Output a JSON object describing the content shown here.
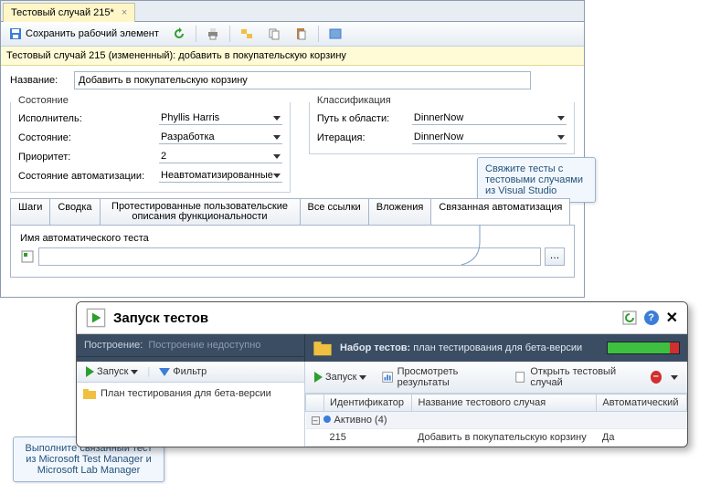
{
  "tab_title": "Тестовый случай 215*",
  "toolbar": {
    "save_label": "Сохранить рабочий элемент"
  },
  "info_bar": "Тестовый случай 215 (измененный): добавить в покупательскую корзину",
  "title_field": {
    "label": "Название:",
    "value": "Добавить в покупательскую корзину"
  },
  "state": {
    "legend": "Состояние",
    "assignee_lbl": "Исполнитель:",
    "assignee": "Phyllis Harris",
    "state_lbl": "Состояние:",
    "state": "Разработка",
    "priority_lbl": "Приоритет:",
    "priority": "2",
    "automation_lbl": "Состояние автоматизации:",
    "automation": "Неавтоматизированные"
  },
  "classification": {
    "legend": "Классификация",
    "area_lbl": "Путь к области:",
    "area": "DinnerNow",
    "iter_lbl": "Итерация:",
    "iter": "DinnerNow"
  },
  "tabs": [
    "Шаги",
    "Сводка",
    "Протестированные пользовательские описания функциональности",
    "Все ссылки",
    "Вложения",
    "Связанная автоматизация"
  ],
  "auto_test": {
    "label": "Имя автоматического теста",
    "value": ""
  },
  "callout1": "Свяжите тесты с тестовыми случаями из Visual Studio",
  "callout2": "Выполните связанный тест из Microsoft Test Manager и Microsoft Lab Manager",
  "mtm": {
    "title": "Запуск тестов",
    "build_lbl": "Построение:",
    "build_val": "Построение недоступно",
    "run_btn": "Запуск",
    "filter_btn": "Фильтр",
    "suite_lbl": "Набор тестов:",
    "suite_name": "план тестирования для бета-версии",
    "tree_item": "План тестирования для бета-версии",
    "view_results": "Просмотреть результаты",
    "open_case": "Открыть тестовый случай",
    "cols": [
      "Идентификатор",
      "Название тестового случая",
      "Автоматический"
    ],
    "group": "Активно (4)",
    "row": {
      "id": "215",
      "name": "Добавить в покупательскую корзину",
      "auto": "Да"
    }
  }
}
